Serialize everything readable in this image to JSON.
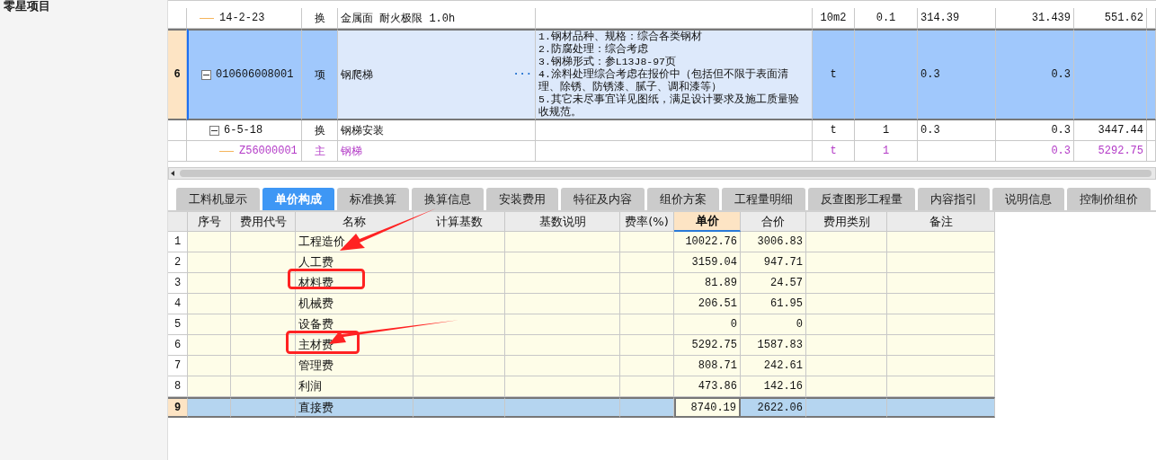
{
  "sidebar": {
    "title": "零星项目"
  },
  "bill_table": {
    "rows": [
      {
        "code": "14-2-23",
        "type": "换",
        "name": "金属面 耐火极限 1.0h",
        "unit": "10m2",
        "column_7": "0.1",
        "column_8": "314.39",
        "column_9": "31.439",
        "column_10": "551.62",
        "selected": false,
        "color": "#111111"
      },
      {
        "number": "6",
        "code": "010606008001",
        "type": "项",
        "name": "钢爬梯",
        "more_button": "···",
        "feature": "1.钢材品种、规格：综合各类钢材\n2.防腐处理：综合考虑\n3.钢梯形式：参L13J8-97页\n4.涂料处理综合考虑在报价中（包括但不限于表面清理、除锈、防锈漆、腻子、调和漆等）\n5.其它未尽事宜详见图纸，满足设计要求及施工质量验收规范。",
        "unit": "t",
        "column_8": "0.3",
        "column_9": "0.3",
        "selected": true,
        "color": "#111111",
        "expanded": true,
        "children": [
          {
            "code": "6-5-18",
            "type": "换",
            "name": "钢梯安装",
            "unit": "t",
            "column_7": "1",
            "column_8": "0.3",
            "column_9": "0.3",
            "column_10": "3447.44",
            "selected": false,
            "color": "#111111",
            "expanded": true,
            "children": [
              {
                "code": "Z56000001",
                "type": "主",
                "name": "钢梯",
                "unit": "t",
                "column_7": "1",
                "column_9": "0.3",
                "column_10": "5292.75",
                "selected": false,
                "color": "#b33ac7"
              }
            ]
          }
        ]
      }
    ]
  },
  "tabs": [
    {
      "label": "工料机显示",
      "selected": false
    },
    {
      "label": "单价构成",
      "selected": true
    },
    {
      "label": "标准换算",
      "selected": false
    },
    {
      "label": "换算信息",
      "selected": false
    },
    {
      "label": "安装费用",
      "selected": false
    },
    {
      "label": "特征及内容",
      "selected": false
    },
    {
      "label": "组价方案",
      "selected": false
    },
    {
      "label": "工程量明细",
      "selected": false
    },
    {
      "label": "反查图形工程量",
      "selected": false
    },
    {
      "label": "内容指引",
      "selected": false
    },
    {
      "label": "说明信息",
      "selected": false
    },
    {
      "label": "控制价组价",
      "selected": false
    }
  ],
  "price_table": {
    "columns": [
      {
        "label": "序号",
        "selected": false
      },
      {
        "label": "费用代号",
        "selected": false
      },
      {
        "label": "名称",
        "selected": false
      },
      {
        "label": "计算基数",
        "selected": false
      },
      {
        "label": "基数说明",
        "selected": false
      },
      {
        "label": "费率(%)",
        "selected": false
      },
      {
        "label": "单价",
        "selected": true
      },
      {
        "label": "合价",
        "selected": false
      },
      {
        "label": "费用类别",
        "selected": false
      },
      {
        "label": "备注",
        "selected": false
      }
    ],
    "rows": [
      {
        "number": "1",
        "name": "工程造价",
        "unit_price": "10022.76",
        "total": "3006.83",
        "selected": false
      },
      {
        "number": "2",
        "name": "人工费",
        "unit_price": "3159.04",
        "total": "947.71",
        "selected": false
      },
      {
        "number": "3",
        "name": "材料费",
        "unit_price": "81.89",
        "total": "24.57",
        "selected": false
      },
      {
        "number": "4",
        "name": "机械费",
        "unit_price": "206.51",
        "total": "61.95",
        "selected": false
      },
      {
        "number": "5",
        "name": "设备费",
        "unit_price": "0",
        "total": "0",
        "selected": false
      },
      {
        "number": "6",
        "name": "主材费",
        "unit_price": "5292.75",
        "total": "1587.83",
        "selected": false
      },
      {
        "number": "7",
        "name": "管理费",
        "unit_price": "808.71",
        "total": "242.61",
        "selected": false
      },
      {
        "number": "8",
        "name": "利润",
        "unit_price": "473.86",
        "total": "142.16",
        "selected": false
      },
      {
        "number": "9",
        "name": "直接费",
        "unit_price": "8740.19",
        "total": "2622.06",
        "selected": true
      }
    ]
  }
}
